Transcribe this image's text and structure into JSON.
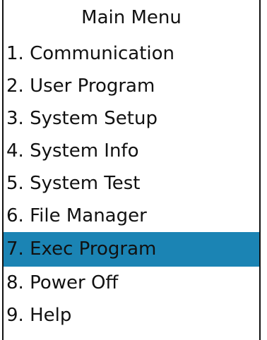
{
  "menu": {
    "title": "Main Menu",
    "selected_index": 6,
    "items": [
      {
        "label": "1. Communication"
      },
      {
        "label": "2. User Program"
      },
      {
        "label": "3. System Setup"
      },
      {
        "label": "4. System Info"
      },
      {
        "label": "5. System Test"
      },
      {
        "label": "6. File Manager"
      },
      {
        "label": "7. Exec Program"
      },
      {
        "label": "8. Power Off"
      },
      {
        "label": "9. Help"
      }
    ]
  },
  "colors": {
    "highlight": "#1b84b4",
    "text": "#111111",
    "background": "#ffffff",
    "border": "#111111"
  }
}
